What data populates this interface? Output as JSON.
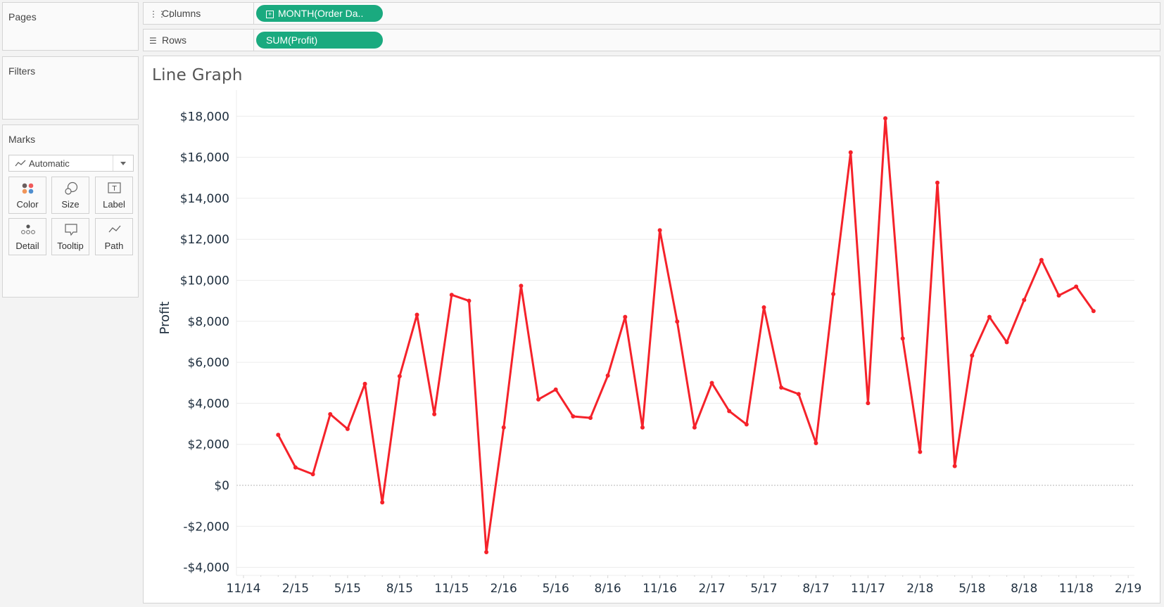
{
  "left_panels": {
    "pages": {
      "title": "Pages"
    },
    "filters": {
      "title": "Filters"
    },
    "marks": {
      "title": "Marks",
      "mark_type": "Automatic",
      "buttons": [
        {
          "label": "Color",
          "icon": "color-icon"
        },
        {
          "label": "Size",
          "icon": "size-icon"
        },
        {
          "label": "Label",
          "icon": "label-icon"
        },
        {
          "label": "Detail",
          "icon": "detail-icon"
        },
        {
          "label": "Tooltip",
          "icon": "tooltip-icon"
        },
        {
          "label": "Path",
          "icon": "path-icon"
        }
      ]
    }
  },
  "shelves": {
    "columns": {
      "label": "Columns",
      "icon": "columns-icon",
      "pill": "MONTH(Order Da.."
    },
    "rows": {
      "label": "Rows",
      "icon": "rows-icon",
      "pill": "SUM(Profit)"
    }
  },
  "colors": {
    "line": "#f5222a",
    "pill": "#1aaa7f"
  },
  "chart_data": {
    "type": "line",
    "title": "Line Graph",
    "xlabel": "",
    "ylabel": "Profit",
    "ylim": [
      -4000,
      18000
    ],
    "yticks": [
      18000,
      16000,
      14000,
      12000,
      10000,
      8000,
      6000,
      4000,
      2000,
      0,
      -2000,
      -4000
    ],
    "ytick_labels": [
      "$18,000",
      "$16,000",
      "$14,000",
      "$12,000",
      "$10,000",
      "$8,000",
      "$6,000",
      "$4,000",
      "$2,000",
      "$0",
      "-$2,000",
      "-$4,000"
    ],
    "xtick_labels": [
      "11/14",
      "2/15",
      "5/15",
      "8/15",
      "11/15",
      "2/16",
      "5/16",
      "8/16",
      "11/16",
      "2/17",
      "5/17",
      "8/17",
      "11/17",
      "2/18",
      "5/18",
      "8/18",
      "11/18",
      "2/19"
    ],
    "grid": true,
    "zero_line": true,
    "series": [
      {
        "name": "SUM(Profit)",
        "x": [
          "1/15",
          "2/15",
          "3/15",
          "4/15",
          "5/15",
          "6/15",
          "7/15",
          "8/15",
          "9/15",
          "10/15",
          "11/15",
          "12/15",
          "1/16",
          "2/16",
          "3/16",
          "4/16",
          "5/16",
          "6/16",
          "7/16",
          "8/16",
          "9/16",
          "10/16",
          "11/16",
          "12/16",
          "1/17",
          "2/17",
          "3/17",
          "4/17",
          "5/17",
          "6/17",
          "7/17",
          "8/17",
          "9/17",
          "10/17",
          "11/17",
          "12/17",
          "1/18",
          "2/18",
          "3/18",
          "4/18",
          "5/18",
          "6/18",
          "7/18",
          "8/18",
          "9/18",
          "10/18",
          "11/18",
          "12/18"
        ],
        "values": [
          2460,
          870,
          540,
          3470,
          2750,
          4950,
          -830,
          5320,
          8320,
          3470,
          9290,
          9000,
          -3260,
          2820,
          9730,
          4190,
          4670,
          3360,
          3290,
          5350,
          8210,
          2820,
          12440,
          7990,
          2820,
          4990,
          3620,
          2970,
          8680,
          4770,
          4450,
          2060,
          9330,
          16240,
          4010,
          17900,
          7160,
          1630,
          14760,
          940,
          6330,
          8210,
          6980,
          9040,
          10990,
          9260,
          9690,
          8500
        ]
      }
    ]
  }
}
